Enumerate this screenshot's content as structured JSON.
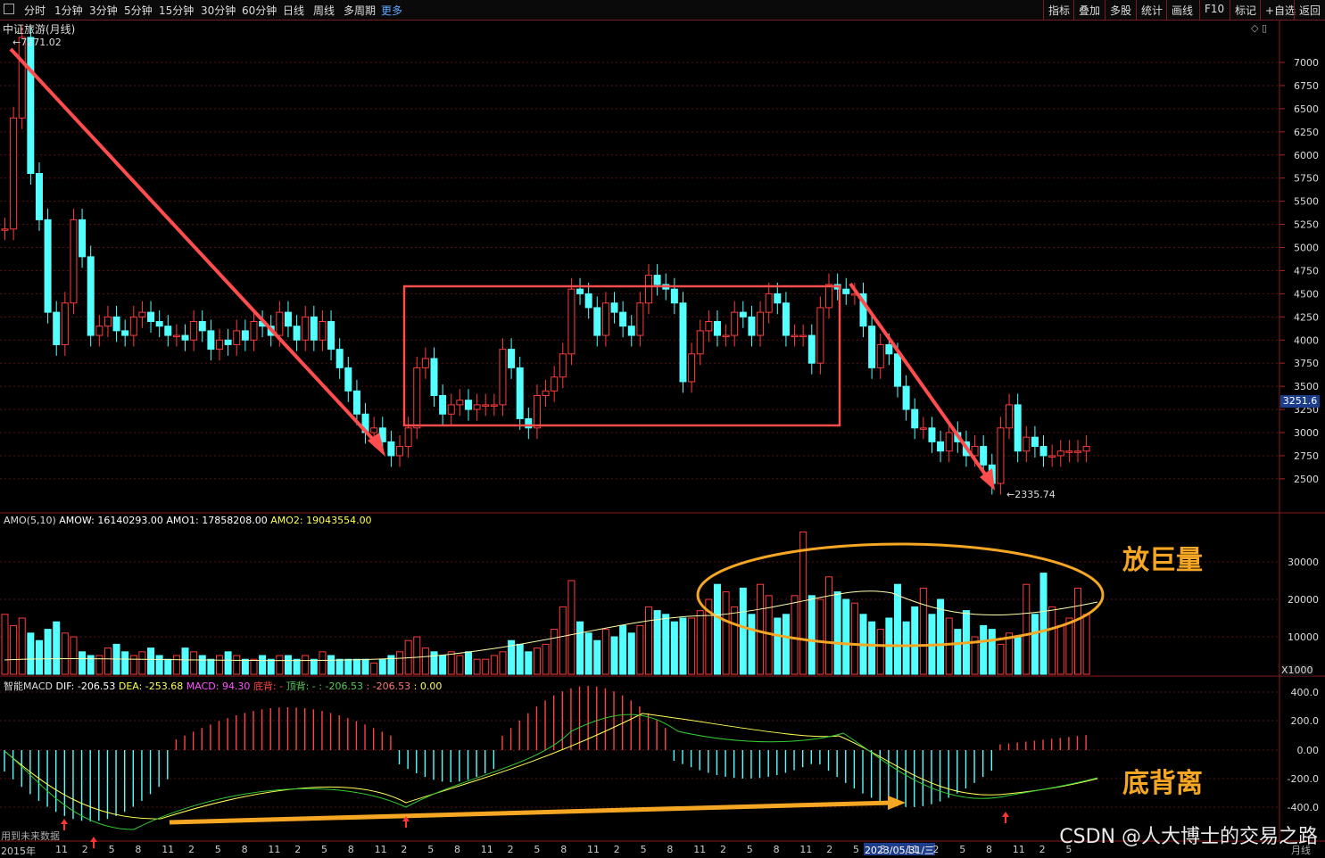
{
  "toolbar": {
    "periods": [
      "分时",
      "1分钟",
      "3分钟",
      "5分钟",
      "15分钟",
      "30分钟",
      "60分钟",
      "日线",
      "周线",
      "多周期"
    ],
    "more": "更多",
    "right": [
      "指标",
      "叠加",
      "多股",
      "统计",
      "画线",
      "F10",
      "标记",
      "+自选",
      "返回"
    ]
  },
  "main_chart": {
    "title": "中证旅游(月线)",
    "high_label": "7271.02",
    "low_label": "2335.74",
    "current_price": "3251.6",
    "price_ticks": [
      "7000",
      "6750",
      "6500",
      "6250",
      "6000",
      "5750",
      "5500",
      "5250",
      "5000",
      "4750",
      "4500",
      "4250",
      "4000",
      "3750",
      "3500",
      "3250",
      "3000",
      "2750",
      "2500"
    ],
    "colors": {
      "up": "#ff3b3b",
      "down": "#54ffff",
      "arrow": "#ff4d4d",
      "box": "#ff4d4d"
    }
  },
  "volume_panel": {
    "legend": [
      "AMO(5,10)",
      "AMOW: 16140293.00",
      "AMO1: 17858208.00",
      "AMO2: 19043554.00"
    ],
    "ticks": [
      "30000",
      "20000",
      "10000"
    ],
    "unit": "X1000",
    "annotation": "放巨量"
  },
  "macd_panel": {
    "legend": [
      "智能MACD",
      "DIF: -206.53",
      "DEA: -253.68",
      "MACD: 94.30",
      "底背: -",
      "顶背: -",
      ": -206.53",
      ": -206.53",
      ": 0.00"
    ],
    "ticks": [
      "400.0",
      "200.0",
      "0.00",
      "-200.0",
      "-400.0"
    ],
    "annotation": "底背离",
    "future_data_label": "用到未来数据"
  },
  "time_axis": {
    "labels": [
      "2015年",
      "11",
      "2",
      "5",
      "8",
      "11",
      "2",
      "5",
      "8",
      "11",
      "2",
      "5",
      "8",
      "11",
      "2",
      "5",
      "8",
      "11",
      "2",
      "5",
      "8",
      "11",
      "2",
      "5",
      "8",
      "11",
      "2",
      "5",
      "8",
      "11",
      "2",
      "5",
      "8",
      "11",
      "2",
      "5",
      "8",
      "11",
      "2",
      "5"
    ],
    "cursor_date": "2023/05/31/三",
    "period_label": "月线"
  },
  "watermark": "CSDN @人大博士的交易之路"
}
